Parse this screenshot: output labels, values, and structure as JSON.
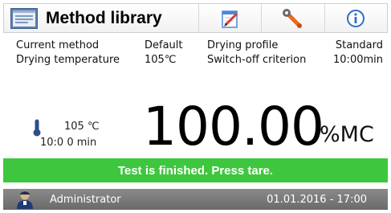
{
  "toolbar": {
    "title": "Method library",
    "icons": [
      "method-library-icon",
      "edit-icon",
      "wrench-icon",
      "info-icon"
    ]
  },
  "method_info": {
    "row1": {
      "label1": "Current method",
      "value1": "Default",
      "label2": "Drying profile",
      "value2": "Standard"
    },
    "row2": {
      "label1": "Drying temperature",
      "value1": "105℃",
      "label2": "Switch-off criterion",
      "value2": "10:00min"
    }
  },
  "readings": {
    "temperature": "105 ℃",
    "time": "10:0 0 min",
    "result_value": "100.00",
    "result_unit": "%MC"
  },
  "status": {
    "message": "Test is finished. Press tare.",
    "color": "#3fc63f"
  },
  "footer": {
    "user": "Administrator",
    "datetime": "01.01.2016 - 17:00"
  }
}
